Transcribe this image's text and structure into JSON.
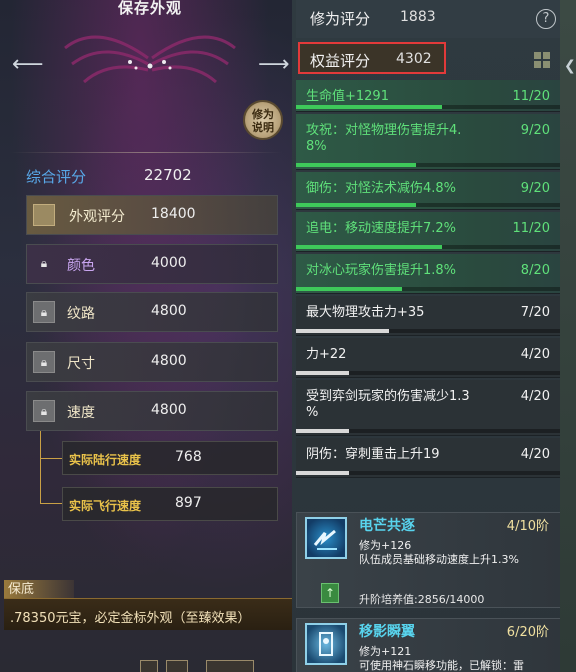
{
  "left": {
    "title": "保存外观",
    "xiuwei_btn": "修为\n说明",
    "total_label": "综合评分",
    "total_value": "22702",
    "stats": [
      {
        "name": "外观评分",
        "value": "18400"
      },
      {
        "name": "颜色",
        "value": "4000"
      },
      {
        "name": "纹路",
        "value": "4800"
      },
      {
        "name": "尺寸",
        "value": "4800"
      },
      {
        "name": "速度",
        "value": "4800"
      }
    ],
    "sub_stats": [
      {
        "name": "实际陆行速度",
        "value": "768"
      },
      {
        "name": "实际飞行速度",
        "value": "897"
      }
    ],
    "baodi_tab": "保底",
    "baodi_text": ".78350元宝，必定金标外观（至臻效果）"
  },
  "right": {
    "header_label": "修为评分",
    "header_value": "1883",
    "help_icon": "?",
    "rights_label": "权益评分",
    "rights_value": "4302",
    "attributes": [
      {
        "name": "生命值+1291",
        "count": "11/20",
        "progress": 0.55,
        "style": "green"
      },
      {
        "name": "攻祝：对怪物理伤害提升4.\n8%",
        "count": "9/20",
        "progress": 0.45,
        "style": "green"
      },
      {
        "name": "御伤：对怪法术减伤4.8%",
        "count": "9/20",
        "progress": 0.45,
        "style": "green"
      },
      {
        "name": "追电：移动速度提升7.2%",
        "count": "11/20",
        "progress": 0.55,
        "style": "green"
      },
      {
        "name": "对冰心玩家伤害提升1.8%",
        "count": "8/20",
        "progress": 0.4,
        "style": "green"
      },
      {
        "name": "最大物理攻击力+35",
        "count": "7/20",
        "progress": 0.35,
        "style": "gray"
      },
      {
        "name": "力+22",
        "count": "4/20",
        "progress": 0.2,
        "style": "gray"
      },
      {
        "name": "受到弈剑玩家的伤害减少1.3\n%",
        "count": "4/20",
        "progress": 0.2,
        "style": "gray"
      },
      {
        "name": "阴伤：穿刺重击上升19",
        "count": "4/20",
        "progress": 0.2,
        "style": "gray"
      }
    ],
    "skills": [
      {
        "name": "电芒共逐",
        "level": "4/10阶",
        "line1": "修为+126",
        "line2": "队伍成员基础移动速度上升1.3%",
        "cultivation": "升阶培养值:2856/14000"
      },
      {
        "name": "移影瞬翼",
        "level": "6/20阶",
        "line1": "修为+121",
        "line2": "可使用神石瞬移功能，已解锁：雷"
      }
    ]
  }
}
